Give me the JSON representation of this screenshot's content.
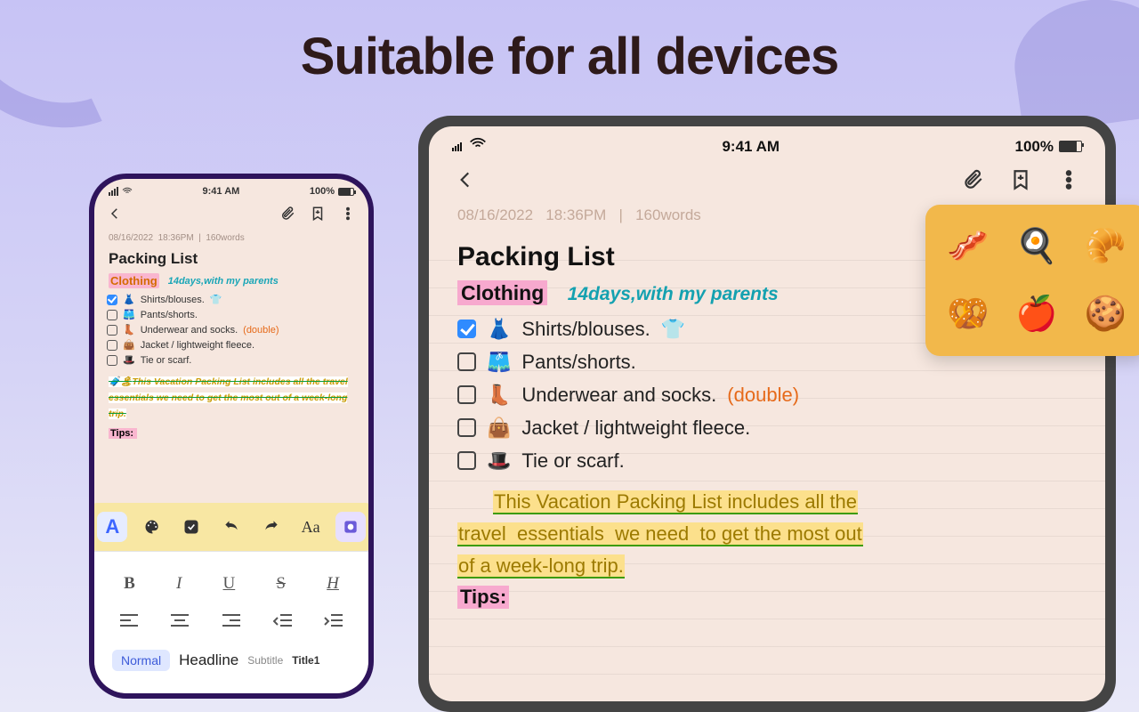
{
  "headline": "Suitable for all devices",
  "status": {
    "time": "9:41 AM",
    "battery_pct": "100%"
  },
  "note": {
    "date": "08/16/2022",
    "time": "18:36PM",
    "wordcount": "160words",
    "title": "Packing List",
    "section": "Clothing",
    "subtitle": "14days,with my parents",
    "items": [
      {
        "checked": true,
        "emoji": "👗",
        "label": "Shirts/blouses.",
        "tail_emoji": "👕"
      },
      {
        "checked": false,
        "emoji": "🩳",
        "label": "Pants/shorts."
      },
      {
        "checked": false,
        "emoji": "👢",
        "label": "Underwear and socks.",
        "extra": "(double)"
      },
      {
        "checked": false,
        "emoji": "👜",
        "label": "Jacket / lightweight fleece."
      },
      {
        "checked": false,
        "emoji": "🎩",
        "label": "Tie or scarf."
      }
    ],
    "paragraph": "This Vacation Packing List includes all the travel essentials we need to get the most out of a week-long trip.",
    "paragraph_small_prefix_emoji": "🧳🏝",
    "tips_label": "Tips:"
  },
  "phone_toolbar": {
    "buttons": [
      "text-style",
      "palette",
      "checkbox",
      "undo",
      "redo",
      "font",
      "sticker"
    ]
  },
  "format_panel": {
    "row1": [
      "B",
      "I",
      "U",
      "S",
      "H"
    ],
    "row2_icons": [
      "align-left",
      "align-center",
      "align-right",
      "indent-decrease",
      "indent-increase"
    ],
    "styles": [
      "Normal",
      "Headline",
      "Subtitle",
      "Title1"
    ]
  },
  "stickers": [
    "🥓",
    "🍳",
    "🥐",
    "🥨",
    "🍎",
    "🍪"
  ]
}
